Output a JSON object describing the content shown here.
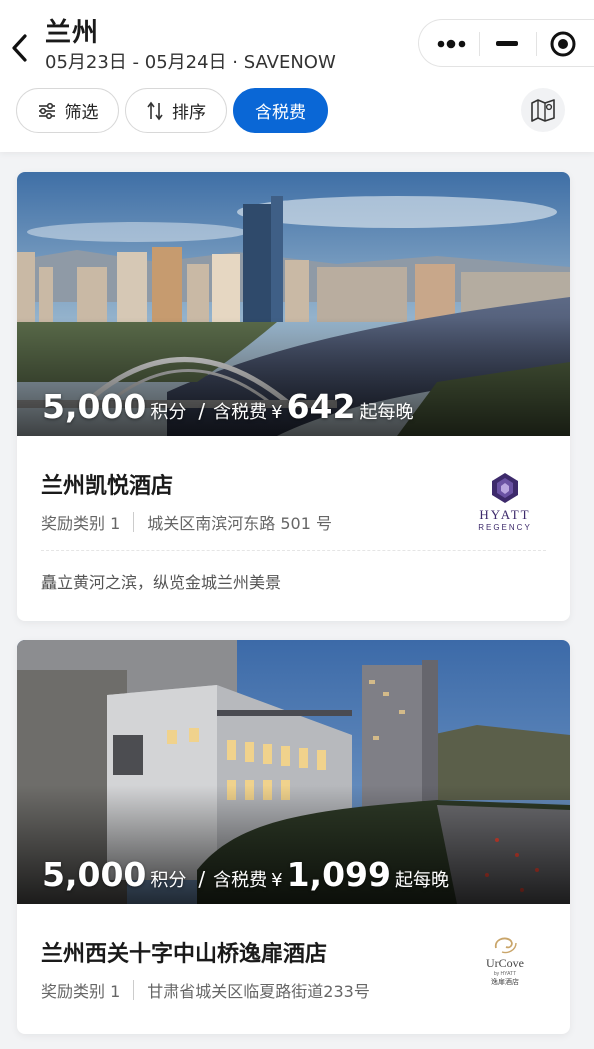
{
  "header": {
    "title": "兰州",
    "subtitle": "05月23日 - 05月24日 · SAVENOW"
  },
  "filters": [
    {
      "label": "筛选",
      "icon": "sliders-icon"
    },
    {
      "label": "排序",
      "icon": "sort-icon"
    },
    {
      "label": "含税费",
      "active": true
    }
  ],
  "colors": {
    "accent": "#0a67d6",
    "hyatt_purple": "#3d2a6b"
  },
  "hotels": [
    {
      "points": "5,000",
      "points_unit": "积分",
      "tax_label": "含税费",
      "currency": "¥",
      "price": "642",
      "price_suffix": "起每晚",
      "name": "兰州凯悦酒店",
      "category": "奖励类别 1",
      "address": "城关区南滨河东路 501 号",
      "description": "矗立黄河之滨，纵览金城兰州美景",
      "brand_logo": {
        "line1": "HYATT",
        "line2": "REGENCY"
      }
    },
    {
      "points": "5,000",
      "points_unit": "积分",
      "tax_label": "含税费",
      "currency": "¥",
      "price": "1,099",
      "price_suffix": "起每晚",
      "name": "兰州西关十字中山桥逸扉酒店",
      "category": "奖励类别 1",
      "address": "甘肃省城关区临夏路街道233号",
      "brand_logo": {
        "line1": "UrCove",
        "line2": "by HYATT",
        "line3": "逸扉酒店"
      }
    }
  ]
}
